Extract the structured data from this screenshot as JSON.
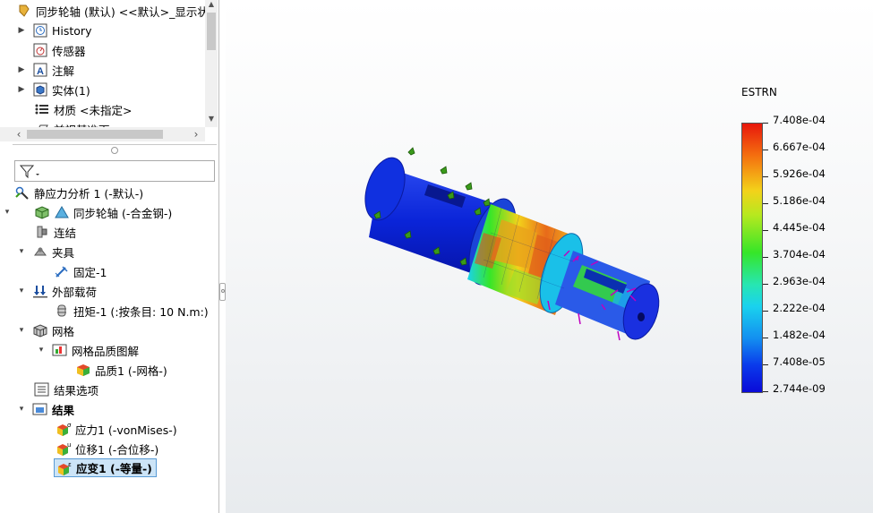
{
  "tree_top": {
    "title": "同步轮轴 (默认) <<默认>_显示状态",
    "items": [
      {
        "label": "History",
        "icon": "history-icon"
      },
      {
        "label": "传感器",
        "icon": "sensor-icon"
      },
      {
        "label": "注解",
        "icon": "annotation-icon"
      },
      {
        "label": "实体(1)",
        "icon": "solid-body-icon"
      },
      {
        "label": "材质 <未指定>",
        "icon": "material-icon"
      },
      {
        "label": "前视基准面",
        "icon": "plane-icon"
      }
    ]
  },
  "tree_bottom": {
    "study": "静应力分析 1 (-默认-)",
    "part": "同步轮轴 (-合金钢-)",
    "connections": "连结",
    "fixtures": "夹具",
    "fixture_item": "固定-1",
    "external_loads": "外部载荷",
    "torque_item": "扭矩-1 (:按条目: 10 N.m:)",
    "mesh": "网格",
    "mesh_quality_plot": "网格品质图解",
    "quality_item": "品质1 (-网格-)",
    "result_options": "结果选项",
    "results": "结果",
    "stress": "应力1 (-vonMises-)",
    "displacement": "位移1 (-合位移-)",
    "strain": "应变1 (-等量-)"
  },
  "legend": {
    "title": "ESTRN",
    "labels": [
      "7.408e-04",
      "6.667e-04",
      "5.926e-04",
      "5.186e-04",
      "4.445e-04",
      "3.704e-04",
      "2.963e-04",
      "2.222e-04",
      "1.482e-04",
      "7.408e-05",
      "2.744e-09"
    ]
  },
  "colors": {
    "selection": "#cce4f7",
    "fixture_marker": "#3a9a1a",
    "load_marker": "#c000c0"
  }
}
